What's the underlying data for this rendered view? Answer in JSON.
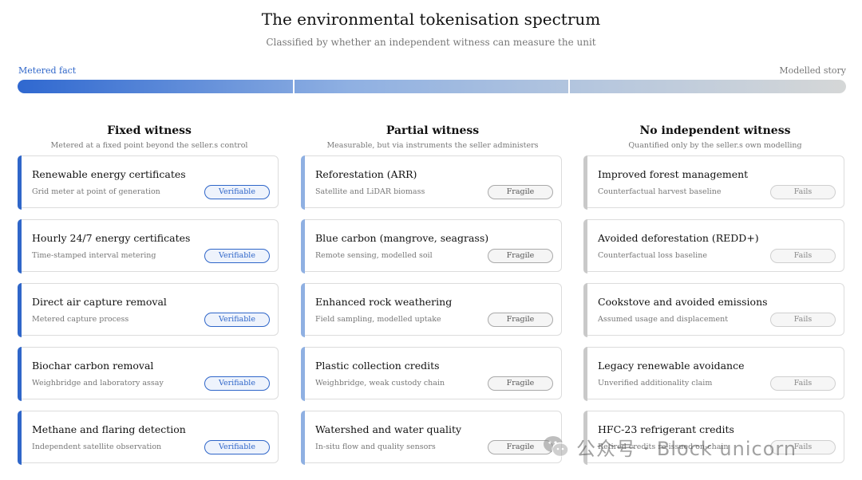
{
  "header": {
    "title": "The environmental tokenisation spectrum",
    "subtitle": "Classified by whether an independent witness can measure the unit"
  },
  "spectrum": {
    "left_label": "Metered fact",
    "right_label": "Modelled story"
  },
  "colors": {
    "verifiable": "#2f66c9",
    "fragile": "#8fb0e2",
    "fails": "#c9c9c9"
  },
  "columns": [
    {
      "title": "Fixed witness",
      "subtitle": "Metered at a fixed point beyond the seller.s control",
      "status": "Verifiable",
      "cards": [
        {
          "name": "Renewable energy certificates",
          "desc": "Grid meter at point of generation"
        },
        {
          "name": "Hourly 24/7 energy certificates",
          "desc": "Time-stamped interval metering"
        },
        {
          "name": "Direct air capture removal",
          "desc": "Metered capture process"
        },
        {
          "name": "Biochar carbon removal",
          "desc": "Weighbridge and laboratory assay"
        },
        {
          "name": "Methane and flaring detection",
          "desc": "Independent satellite observation"
        }
      ]
    },
    {
      "title": "Partial witness",
      "subtitle": "Measurable, but via instruments the seller administers",
      "status": "Fragile",
      "cards": [
        {
          "name": "Reforestation (ARR)",
          "desc": "Satellite and LiDAR biomass"
        },
        {
          "name": "Blue carbon (mangrove, seagrass)",
          "desc": "Remote sensing, modelled soil"
        },
        {
          "name": "Enhanced rock weathering",
          "desc": "Field sampling, modelled uptake"
        },
        {
          "name": "Plastic collection credits",
          "desc": "Weighbridge, weak custody chain"
        },
        {
          "name": "Watershed and water quality",
          "desc": "In-situ flow and quality sensors"
        }
      ]
    },
    {
      "title": "No independent witness",
      "subtitle": "Quantified only by the seller.s own modelling",
      "status": "Fails",
      "cards": [
        {
          "name": "Improved forest management",
          "desc": "Counterfactual harvest baseline"
        },
        {
          "name": "Avoided deforestation (REDD+)",
          "desc": "Counterfactual loss baseline"
        },
        {
          "name": "Cookstove and avoided emissions",
          "desc": "Assumed usage and displacement"
        },
        {
          "name": "Legacy renewable avoidance",
          "desc": "Unverified additionality claim"
        },
        {
          "name": "HFC-23 refrigerant credits",
          "desc": "Retired credits re-issued on-chain"
        }
      ]
    }
  ],
  "watermark": {
    "text": "公众号 · Block unicorn",
    "icon": "wechat-icon"
  }
}
